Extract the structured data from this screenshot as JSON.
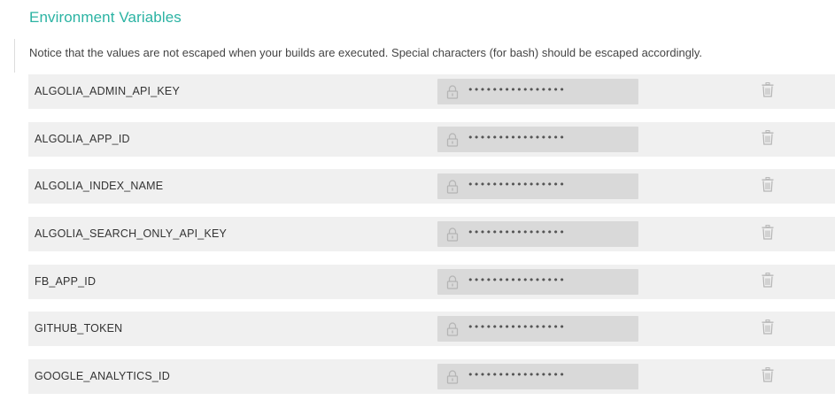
{
  "section": {
    "title": "Environment Variables",
    "notice": "Notice that the values are not escaped when your builds are executed. Special characters (for bash) should be escaped accordingly."
  },
  "variables": [
    {
      "key": "ALGOLIA_ADMIN_API_KEY",
      "masked_value": "••••••••••••••••"
    },
    {
      "key": "ALGOLIA_APP_ID",
      "masked_value": "••••••••••••••••"
    },
    {
      "key": "ALGOLIA_INDEX_NAME",
      "masked_value": "••••••••••••••••"
    },
    {
      "key": "ALGOLIA_SEARCH_ONLY_API_KEY",
      "masked_value": "••••••••••••••••"
    },
    {
      "key": "FB_APP_ID",
      "masked_value": "••••••••••••••••"
    },
    {
      "key": "GITHUB_TOKEN",
      "masked_value": "••••••••••••••••"
    },
    {
      "key": "GOOGLE_ANALYTICS_ID",
      "masked_value": "••••••••••••••••"
    }
  ],
  "icons": {
    "lock": "lock-icon",
    "trash": "trash-icon"
  },
  "colors": {
    "title": "#2bb3a3",
    "row_bg": "#f0f0f0",
    "value_bg": "#d9d9d9",
    "icon": "#b5b5b5"
  }
}
